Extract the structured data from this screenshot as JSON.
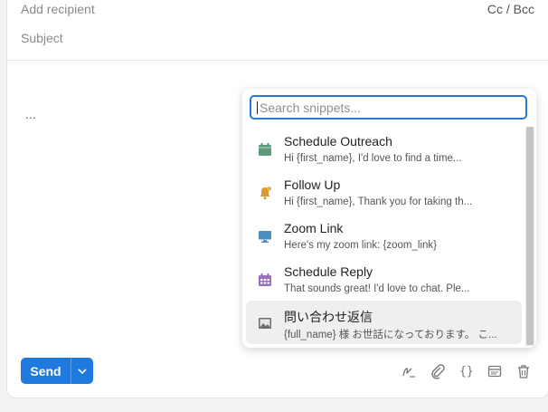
{
  "compose": {
    "recipient_placeholder": "Add recipient",
    "ccbcc_label": "Cc / Bcc",
    "subject_placeholder": "Subject",
    "body_text": "..."
  },
  "footer": {
    "send_label": "Send",
    "icons": [
      "signature-icon",
      "attach-icon",
      "variables-icon",
      "template-icon",
      "trash-icon"
    ]
  },
  "snippets": {
    "search_placeholder": "Search snippets...",
    "items": [
      {
        "title": "Schedule Outreach",
        "preview": "Hi {first_name}, I'd love to find a time...",
        "icon": "calendar-add-icon",
        "color": "#5a9b78"
      },
      {
        "title": "Follow Up",
        "preview": "Hi {first_name}, Thank you for taking th...",
        "icon": "bell-icon",
        "color": "#d89a2e"
      },
      {
        "title": "Zoom Link",
        "preview": "Here's my zoom link: {zoom_link}",
        "icon": "monitor-icon",
        "color": "#4a8ec2"
      },
      {
        "title": "Schedule Reply",
        "preview": "That sounds great! I'd love to chat. Ple...",
        "icon": "calendar-grid-icon",
        "color": "#9b6fc0"
      },
      {
        "title": "問い合わせ返信",
        "preview": "{full_name} 様 お世話になっております。 こ...",
        "icon": "image-icon",
        "color": "#6d6d6d"
      }
    ]
  }
}
